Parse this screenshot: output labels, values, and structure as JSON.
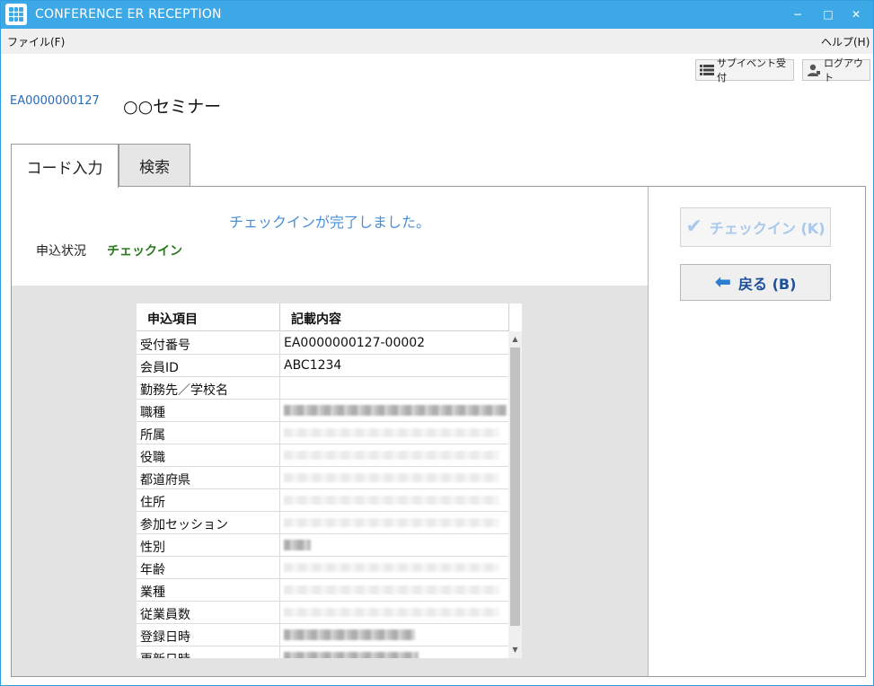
{
  "window": {
    "title": "CONFERENCE ER RECEPTION",
    "controls": {
      "minimize": "−",
      "maximize": "□",
      "close": "✕"
    }
  },
  "menu": {
    "file": "ファイル(F)",
    "help": "ヘルプ(H)"
  },
  "toolbar": {
    "sub_event_label": "サブイベント受付",
    "logout_label": "ログアウト"
  },
  "event": {
    "id": "EA0000000127",
    "name": "○○セミナー"
  },
  "tabs": [
    {
      "label": "コード入力",
      "active": true
    },
    {
      "label": "検索",
      "active": false
    }
  ],
  "result": {
    "message": "チェックインが完了しました。",
    "status_label": "申込状況",
    "status_value": "チェックイン",
    "status_color": "#2a7a1e"
  },
  "table": {
    "headers": [
      "申込項目",
      "記載内容"
    ],
    "rows": [
      {
        "item": "受付番号",
        "value": "EA0000000127-00002"
      },
      {
        "item": "会員ID",
        "value": "ABC1234"
      },
      {
        "item": "勤務先／学校名",
        "value": ""
      },
      {
        "item": "職種",
        "value": ""
      },
      {
        "item": "所属",
        "value": ""
      },
      {
        "item": "役職",
        "value": ""
      },
      {
        "item": "都道府県",
        "value": ""
      },
      {
        "item": "住所",
        "value": ""
      },
      {
        "item": "参加セッション",
        "value": ""
      },
      {
        "item": "性別",
        "value": ""
      },
      {
        "item": "年齢",
        "value": ""
      },
      {
        "item": "業種",
        "value": ""
      },
      {
        "item": "従業員数",
        "value": ""
      },
      {
        "item": "登録日時",
        "value": ""
      },
      {
        "item": "更新日時",
        "value": ""
      }
    ],
    "scroll": {
      "up": "▲",
      "down": "▼"
    }
  },
  "actions": {
    "checkin_label": "チェックイン (K)",
    "checkin_icon": "✔",
    "back_label": "戻る (B)",
    "back_icon": "⬅"
  },
  "colors": {
    "title_bar": "#3da8e6",
    "accent": "#4a8fd6",
    "back_button_text": "#1e4f9a"
  }
}
